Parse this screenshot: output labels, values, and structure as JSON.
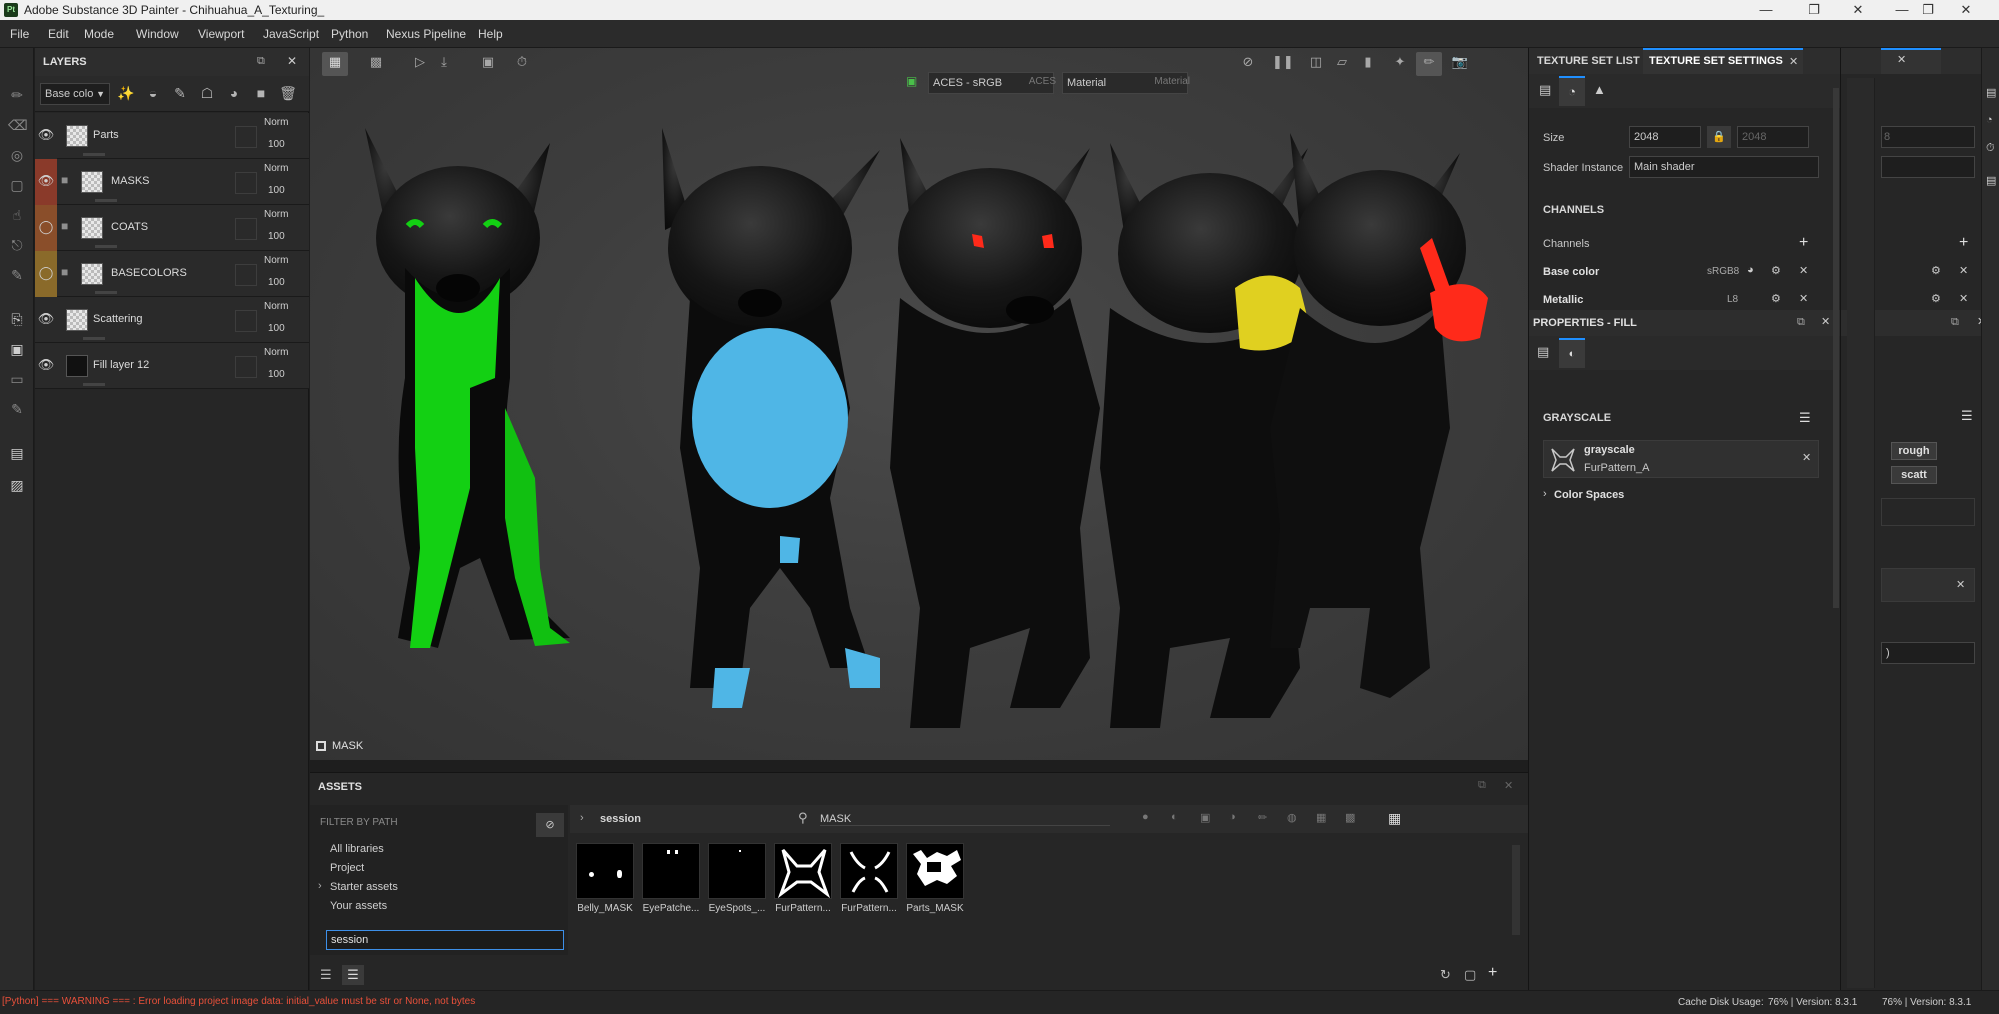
{
  "window": {
    "title": "Adobe Substance 3D Painter - Chihuahua_A_Texturing_",
    "app_icon": "Pt",
    "controls": [
      "minimize-icon",
      "restore-icon",
      "close-icon",
      "minimize-icon",
      "restore-icon"
    ]
  },
  "menu": [
    "File",
    "Edit",
    "Mode",
    "Window",
    "Viewport",
    "JavaScript",
    "Python",
    "Nexus Pipeline",
    "Help"
  ],
  "layers_panel": {
    "title": "LAYERS",
    "channel_select": "Base colo",
    "layers": [
      {
        "name": "Parts",
        "blend": "Norm",
        "opacity": "100",
        "color": "#2a2a2a",
        "folder": false
      },
      {
        "name": "MASKS",
        "blend": "Norm",
        "opacity": "100",
        "color": "#8a3a2a",
        "folder": true
      },
      {
        "name": "COATS",
        "blend": "Norm",
        "opacity": "100",
        "color": "#8a4e2a",
        "folder": true
      },
      {
        "name": "BASECOLORS",
        "blend": "Norm",
        "opacity": "100",
        "color": "#8a6a2a",
        "folder": true
      },
      {
        "name": "Scattering",
        "blend": "Norm",
        "opacity": "100",
        "color": "#2a2a2a",
        "folder": false
      },
      {
        "name": "Fill layer 12",
        "blend": "Norm",
        "opacity": "100",
        "color": "#2a2a2a",
        "folder": false
      }
    ]
  },
  "viewport": {
    "colorspace": "ACES - sRGB",
    "colorspace2": "ACES",
    "display_mode": "Material",
    "display_mode2": "Material",
    "bottom_label": "MASK"
  },
  "assets": {
    "title": "ASSETS",
    "filter_label": "FILTER BY PATH",
    "tree": [
      "All libraries",
      "Project",
      "Starter assets",
      "Your assets"
    ],
    "filter_input": "session",
    "breadcrumb": "session",
    "search": "MASK",
    "items": [
      "Belly_MASK",
      "EyePatche...",
      "EyeSpots_...",
      "FurPattern...",
      "FurPattern...",
      "Parts_MASK"
    ]
  },
  "texture_set": {
    "tab1": "TEXTURE SET LIST",
    "tab2": "TEXTURE SET SETTINGS",
    "size_label": "Size",
    "size_value": "2048",
    "size_value2": "2048",
    "shader_label": "Shader Instance",
    "shader_value": "Main shader",
    "channels_header": "CHANNELS",
    "channels_label": "Channels",
    "channels": [
      {
        "name": "Base color",
        "format": "sRGB8"
      },
      {
        "name": "Metallic",
        "format": "L8"
      }
    ]
  },
  "properties": {
    "title": "PROPERTIES - FILL",
    "section": "GRAYSCALE",
    "resource_name": "grayscale",
    "resource_sub": "FurPattern_A",
    "color_spaces": "Color Spaces"
  },
  "far_right": {
    "value_partial": "8",
    "btn1": "rough",
    "btn2": "scatt",
    "select_partial": ")"
  },
  "status": {
    "error": "[Python] === WARNING === : Error loading project image data: initial_value must be str or None, not bytes",
    "cache": "Cache Disk Usage:",
    "cache_value": "76% | Version: 8.3.1",
    "cache_value2": "76% | Version: 8.3.1"
  },
  "colors": {
    "accent": "#1f8fff",
    "error_text": "#e8503a",
    "green_paint": "#10d010",
    "blue_paint": "#4ab4e6",
    "red_paint": "#ff2a1a",
    "yellow_paint": "#e0d020"
  }
}
